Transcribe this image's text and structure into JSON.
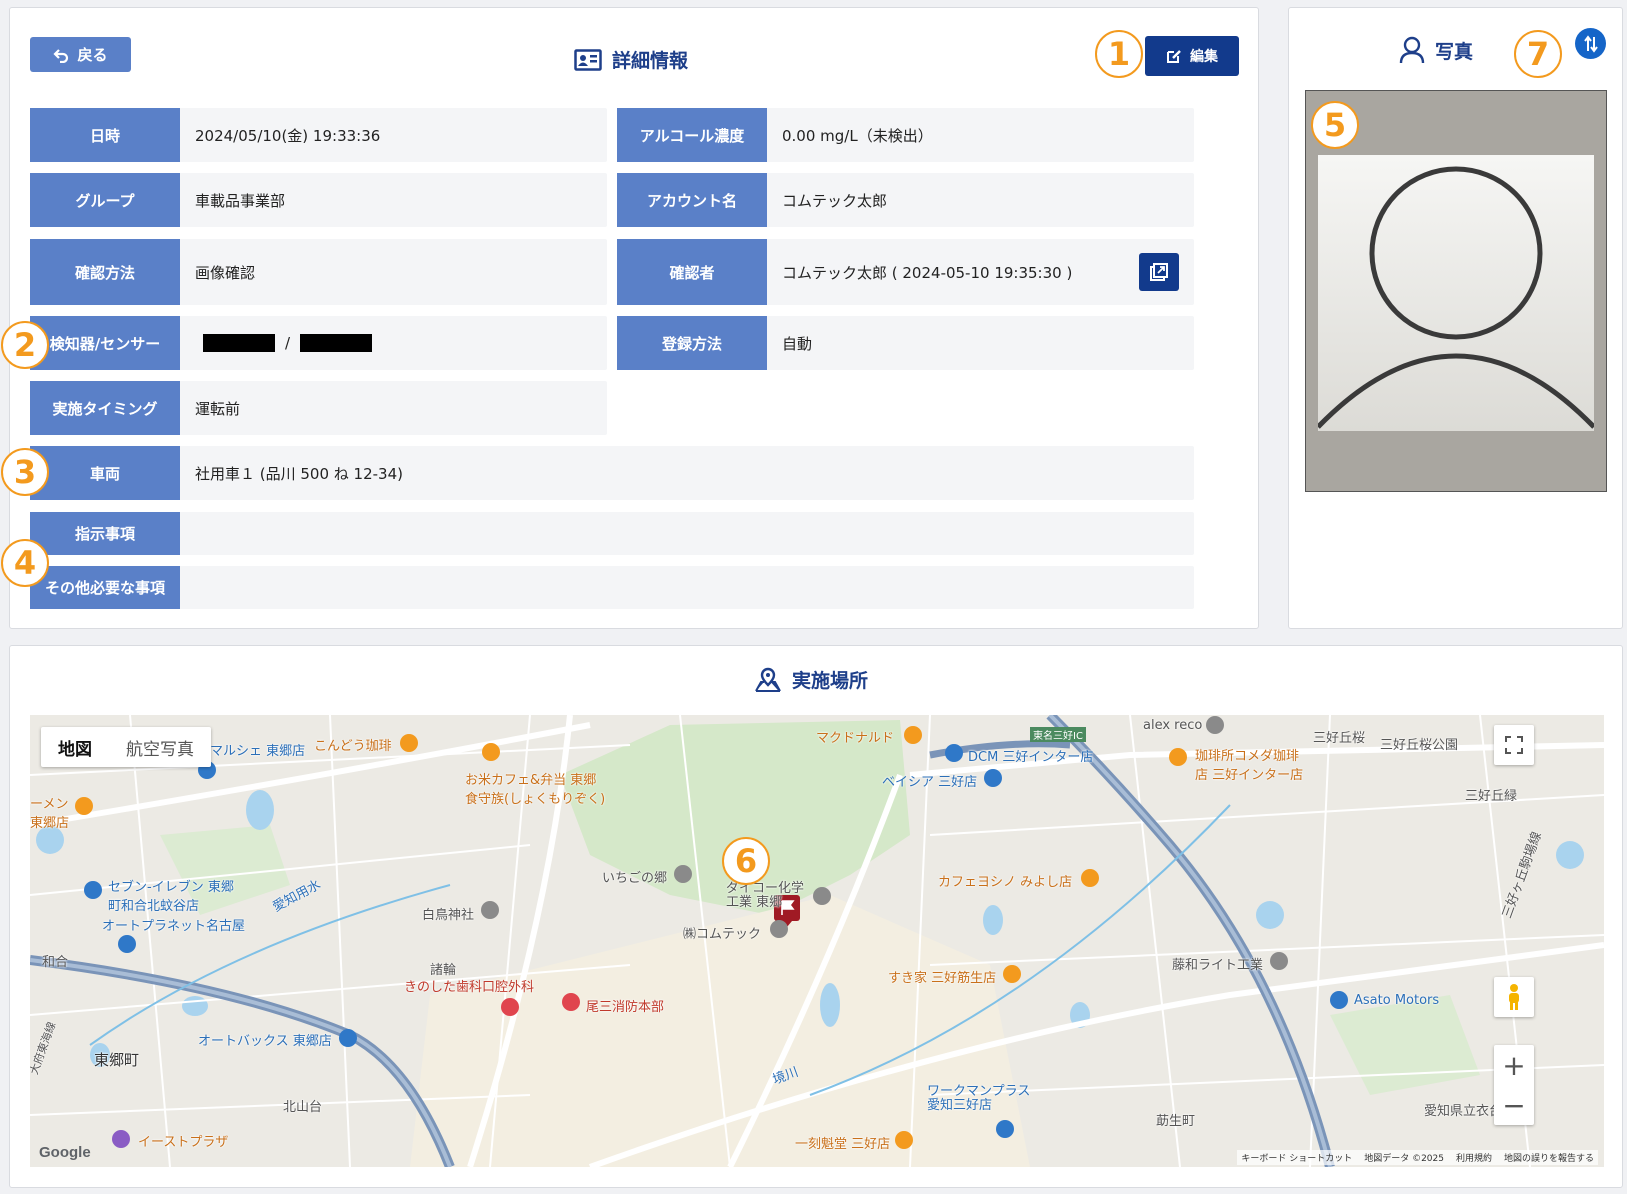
{
  "detail": {
    "back_label": "戻る",
    "title": "詳細情報",
    "edit_label": "編集",
    "rows": {
      "datetime": {
        "label": "日時",
        "value": "2024/05/10(金)  19:33:36"
      },
      "alcohol": {
        "label": "アルコール濃度",
        "value": "0.00 mg/L（未検出）"
      },
      "group": {
        "label": "グループ",
        "value": "車載品事業部"
      },
      "account": {
        "label": "アカウント名",
        "value": "コムテック太郎"
      },
      "method": {
        "label": "確認方法",
        "value": "画像確認"
      },
      "confirmer": {
        "label": "確認者",
        "value": "コムテック太郎 ( 2024-05-10  19:35:30  )"
      },
      "detector": {
        "label": "検知器/センサー",
        "separator": "/"
      },
      "registration": {
        "label": "登録方法",
        "value": "自動"
      },
      "timing": {
        "label": "実施タイミング",
        "value": "運転前"
      },
      "vehicle": {
        "label": "車両",
        "value": "社用車１ (品川 500 ね 12-34)"
      },
      "instructions": {
        "label": "指示事項",
        "value": ""
      },
      "other": {
        "label": "その他必要な事項",
        "value": ""
      }
    }
  },
  "photo": {
    "title": "写真"
  },
  "map": {
    "title": "実施場所",
    "tab_map": "地図",
    "tab_aerial": "航空写真",
    "zoom_in": "+",
    "zoom_out": "−",
    "google": "Google",
    "footer": [
      "キーボード ショートカット",
      "地図データ ©2025",
      "利用規約",
      "地図の誤りを報告する"
    ],
    "labels": {
      "mcdonalds": "マクドナルド",
      "dcm": "DCM 三好インター店",
      "beisia": "ベイシア 三好店",
      "alex": "alex reco",
      "komeda": "珈琲所コメダ珈琲\n店 三好インター店",
      "miyoshigaoka_sakura": "三好丘桜",
      "miyoshigaoka_park": "三好丘桜公園",
      "miyoshigaoka": "三好丘緑",
      "marche": "マルシェ 東郷店",
      "kondou": "こんどう珈琲",
      "okome": "お米カフェ&弁当 東郷\n食守族(しょくもりぞく)",
      "ramen": "ーメン\n東郷店",
      "seven": "セブン-イレブン 東郷\n町和合北蚊谷店",
      "autoplanet": "オートプラネット名古屋",
      "ichigo": "いちごの郷",
      "daikou": "ダイコー化学\n工業 東郷",
      "comtec": "㈱コムテック",
      "cafe_yoshino": "カフェヨシノ みよし店",
      "shiratori": "白鳥神社",
      "kinoshita": "きのした歯科口腔外科",
      "moroha": "諸輪",
      "owari": "尾三消防本部",
      "sukiya": "すき家 三好筋生店",
      "fujiwa": "藤和ライト工業",
      "asato": "Asato Motors",
      "wago": "和合",
      "autobacs": "オートバックス 東郷店",
      "togo": "東郷町",
      "kitayama": "北山台",
      "aeon": "イーストプラザ",
      "workman": "ワークマンプラス\n愛知三好店",
      "ikkoku": "一刻魁堂 三好店",
      "ikusei": "莇生町",
      "koromo": "愛知県立衣台高",
      "aichi_yousui": "愛知用水",
      "sakaigawa": "境川",
      "toumei": "東名三好IC",
      "miyoshigaoka_line": "三好ヶ丘駒場線",
      "toukaidou": "大府東海線"
    }
  }
}
